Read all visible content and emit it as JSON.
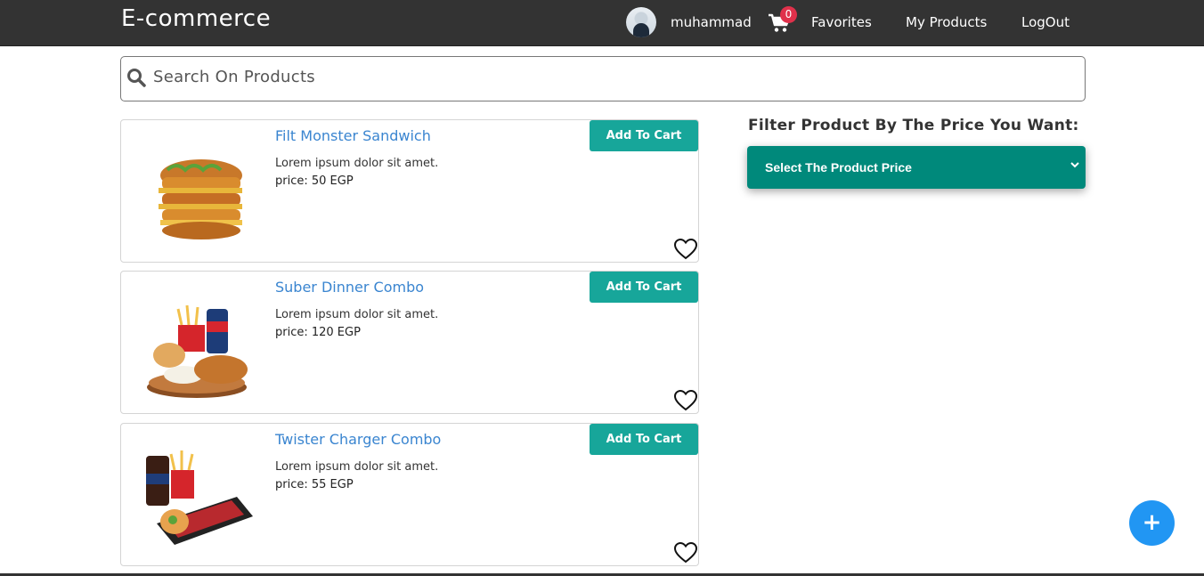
{
  "navbar": {
    "brand": "E-commerce",
    "username": "muhammad",
    "cart_count": "0",
    "links": [
      "Favorites",
      "My Products",
      "LogOut"
    ]
  },
  "search": {
    "placeholder": "Search On Products"
  },
  "products": [
    {
      "title": "Filt Monster Sandwich",
      "description": "Lorem ipsum dolor sit amet.",
      "price": "price: 50 EGP",
      "button": "Add To Cart"
    },
    {
      "title": "Suber Dinner Combo",
      "description": "Lorem ipsum dolor sit amet.",
      "price": "price: 120 EGP",
      "button": "Add To Cart"
    },
    {
      "title": "Twister Charger Combo",
      "description": "Lorem ipsum dolor sit amet.",
      "price": "price: 55 EGP",
      "button": "Add To Cart"
    }
  ],
  "filter": {
    "label": "Filter Product By The Price You Want:",
    "selected": "Select The Product Price"
  },
  "fab": {
    "label": "+"
  },
  "icons": [
    "avatar",
    "cart-icon",
    "search-icon",
    "heart-icon",
    "chevron-down-icon",
    "plus-icon"
  ],
  "colors": {
    "navbar": "#333333",
    "accent": "#17a69a",
    "select": "#00897b",
    "title": "#3a85d0",
    "badge": "#e0314b",
    "fab": "#2196f3"
  }
}
